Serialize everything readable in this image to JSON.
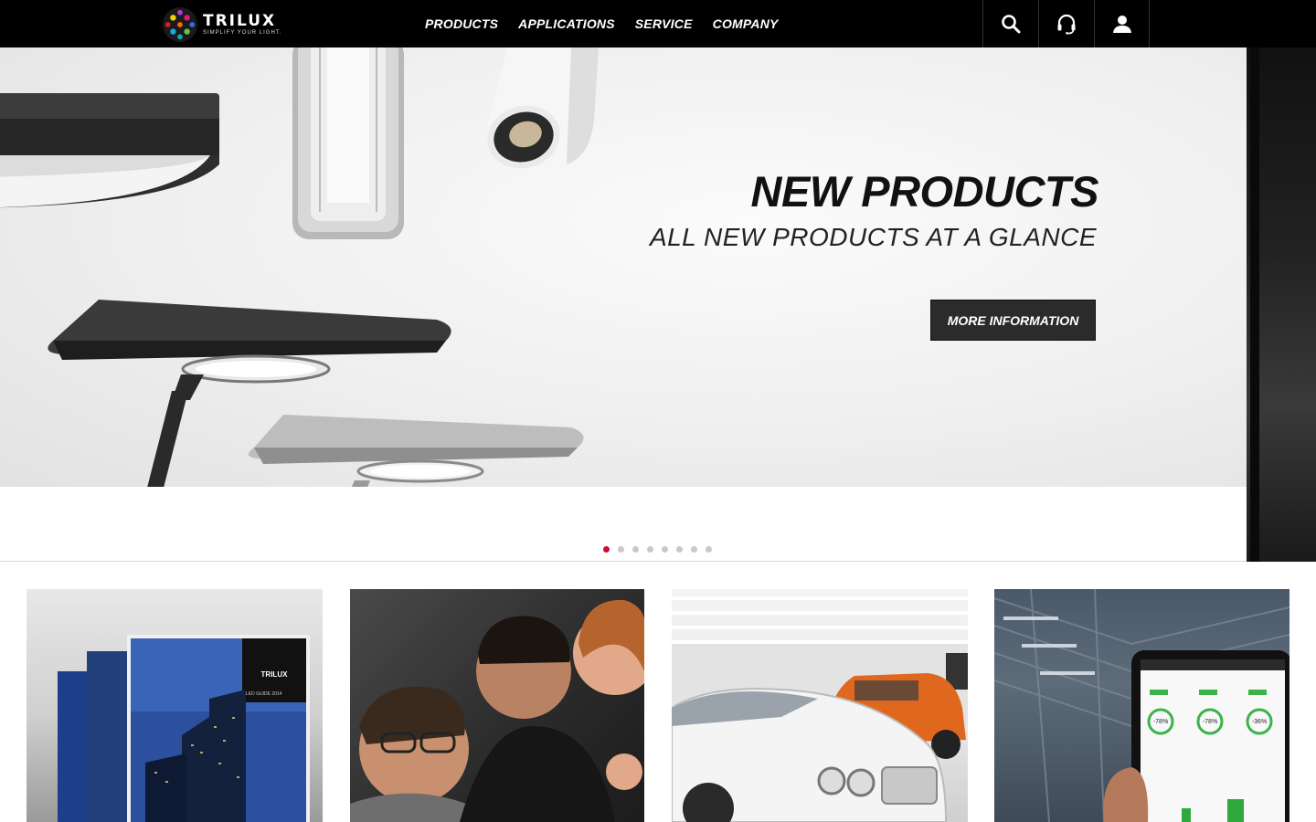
{
  "brand": {
    "name": "TRILUX",
    "tagline": "SIMPLIFY YOUR LIGHT."
  },
  "nav": {
    "items": [
      "PRODUCTS",
      "APPLICATIONS",
      "SERVICE",
      "COMPANY"
    ]
  },
  "utility": {
    "icons": [
      "search-icon",
      "headset-icon",
      "user-icon"
    ]
  },
  "hero": {
    "title": "NEW PRODUCTS",
    "subtitle": "ALL NEW PRODUCTS AT A GLANCE",
    "button_label": "MORE INFORMATION",
    "slide_count": 8,
    "active_slide": 1
  },
  "tiles": {
    "brochure": {
      "logo_text": "TRILUX",
      "caption": "LED GUIDE 2014"
    },
    "dashboard": {
      "stat1": "-78%",
      "stat2": "-78%",
      "stat3": "-36%"
    }
  },
  "colors": {
    "accent_red": "#c8102e",
    "header_bg": "#000000",
    "button_bg": "#2b2b2b"
  }
}
